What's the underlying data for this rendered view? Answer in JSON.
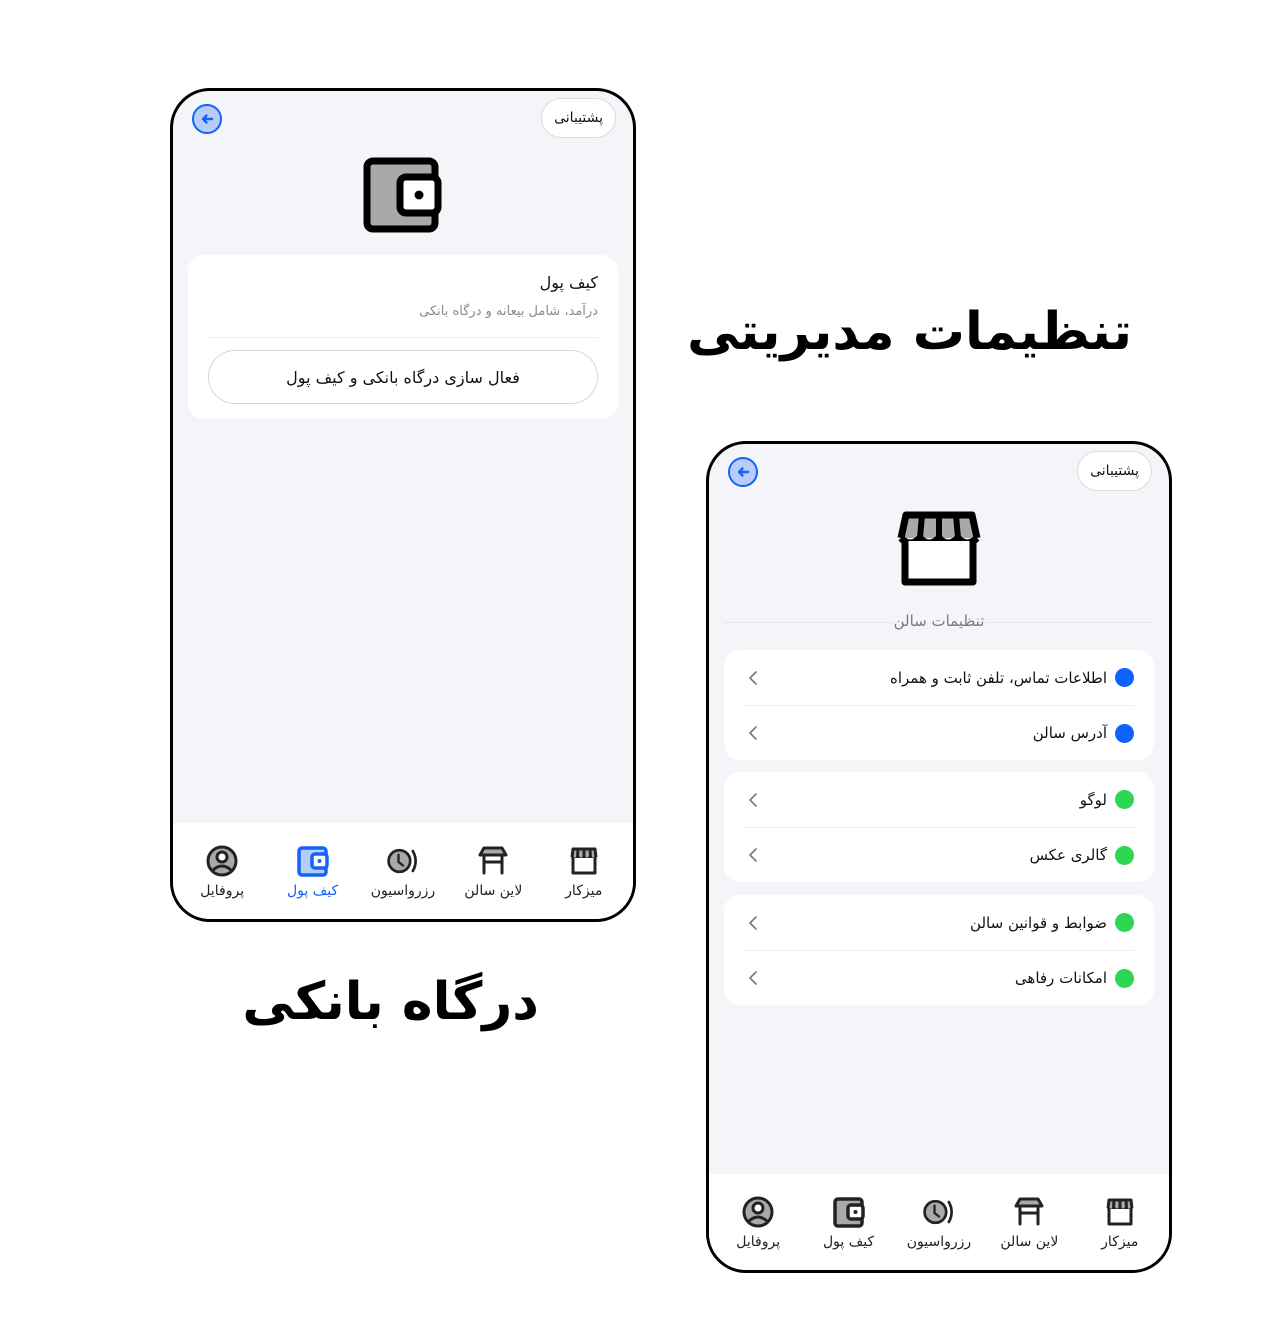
{
  "headlines": {
    "settings": "تنظیمات مدیریتی",
    "gateway": "درگاه بانکی"
  },
  "colors": {
    "accent": "#1463f5",
    "blue_dot": "#0f62fe",
    "green_dot": "#2fd654",
    "background": "#f4f5f9"
  },
  "wallet_screen": {
    "support_label": "پشتیبانی",
    "back_icon": "arrow-left-circle-icon",
    "hero_icon": "wallet-icon",
    "card": {
      "title": "کیف پول",
      "subtitle": "درآمد، شامل بیعانه و درگاه بانکی",
      "button_label": "فعال سازی درگاه بانکی و کیف پول"
    },
    "tabs": [
      {
        "label": "میزکار",
        "icon": "storefront-icon",
        "active": false
      },
      {
        "label": "لاین سالن",
        "icon": "table-icon",
        "active": false
      },
      {
        "label": "رزرواسیون",
        "icon": "clock-icon",
        "active": false
      },
      {
        "label": "کیف پول",
        "icon": "wallet-icon",
        "active": true
      },
      {
        "label": "پروفایل",
        "icon": "profile-icon",
        "active": false
      }
    ]
  },
  "settings_screen": {
    "support_label": "پشتیبانی",
    "back_icon": "arrow-left-circle-icon",
    "hero_icon": "storefront-icon",
    "section_title": "تنظیمات سالن",
    "groups": [
      {
        "items": [
          {
            "label": "اطلاعات تماس، تلفن ثابت و همراه",
            "status": "blue"
          },
          {
            "label": "آدرس سالن",
            "status": "blue"
          }
        ]
      },
      {
        "items": [
          {
            "label": "لوگو",
            "status": "green"
          },
          {
            "label": "گالری عکس",
            "status": "green"
          }
        ]
      },
      {
        "items": [
          {
            "label": "ضوابط و قوانین سالن",
            "status": "green"
          },
          {
            "label": "امکانات رفاهی",
            "status": "green"
          }
        ]
      }
    ],
    "tabs": [
      {
        "label": "میزکار",
        "icon": "storefront-icon",
        "active": false
      },
      {
        "label": "لاین سالن",
        "icon": "table-icon",
        "active": false
      },
      {
        "label": "رزرواسیون",
        "icon": "clock-icon",
        "active": false
      },
      {
        "label": "کیف پول",
        "icon": "wallet-icon",
        "active": false
      },
      {
        "label": "پروفایل",
        "icon": "profile-icon",
        "active": false
      }
    ]
  }
}
